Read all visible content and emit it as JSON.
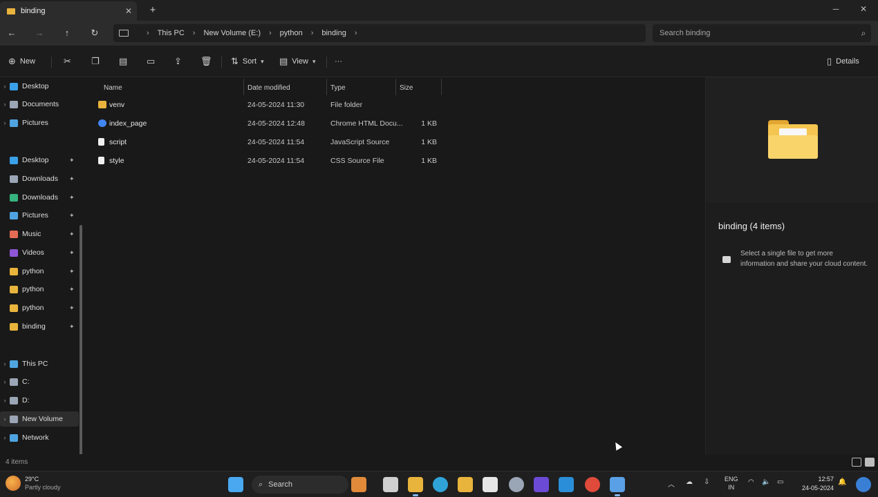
{
  "window": {
    "tab_title": "binding",
    "new_tab_label": "+",
    "tab_close_label": "✕",
    "minimize_label": "─",
    "close_label": "✕"
  },
  "address": {
    "breadcrumbs": [
      "This PC",
      "New Volume (E:)",
      "python",
      "binding"
    ]
  },
  "search": {
    "placeholder": "Search binding"
  },
  "commands": {
    "new_label": "New",
    "sort_label": "Sort",
    "view_label": "View",
    "more_label": "···",
    "details_label": "Details"
  },
  "nav": {
    "items": [
      {
        "label": "Desktop",
        "color": "#3aa0e8",
        "pinned": false,
        "chevron": true
      },
      {
        "label": "Documents",
        "color": "#9aa5b5",
        "pinned": false,
        "chevron": true
      },
      {
        "label": "Pictures",
        "color": "#4fa3e0",
        "pinned": false,
        "chevron": true
      },
      {
        "label": "Desktop",
        "color": "#3aa0e8",
        "pinned": true,
        "chevron": false
      },
      {
        "label": "Downloads",
        "color": "#9aa5b5",
        "pinned": true,
        "chevron": false
      },
      {
        "label": "Downloads",
        "color": "#36b37e",
        "pinned": true,
        "chevron": false
      },
      {
        "label": "Pictures",
        "color": "#4fa3e0",
        "pinned": true,
        "chevron": false
      },
      {
        "label": "Music",
        "color": "#e56b55",
        "pinned": true,
        "chevron": false
      },
      {
        "label": "Videos",
        "color": "#8e55d6",
        "pinned": true,
        "chevron": false
      },
      {
        "label": "python",
        "color": "#e8b43c",
        "pinned": true,
        "chevron": false
      },
      {
        "label": "python",
        "color": "#e8b43c",
        "pinned": true,
        "chevron": false
      },
      {
        "label": "python",
        "color": "#e8b43c",
        "pinned": true,
        "chevron": false
      },
      {
        "label": "binding",
        "color": "#e8b43c",
        "pinned": true,
        "chevron": false
      },
      {
        "label": "This PC",
        "color": "#4fa3e0",
        "pinned": false,
        "chevron": true
      },
      {
        "label": "C:",
        "color": "#9aa5b5",
        "pinned": false,
        "chevron": true
      },
      {
        "label": "D:",
        "color": "#9aa5b5",
        "pinned": false,
        "chevron": true
      },
      {
        "label": "New Volume",
        "color": "#9aa5b5",
        "pinned": false,
        "chevron": true
      },
      {
        "label": "Network",
        "color": "#4fa3e0",
        "pinned": false,
        "chevron": true
      }
    ]
  },
  "columns": [
    "Name",
    "Date modified",
    "Type",
    "Size"
  ],
  "files": [
    {
      "name": "venv",
      "date": "24-05-2024 11:30",
      "type": "File folder",
      "size": "",
      "icon": "folder",
      "color": "#e8b43c"
    },
    {
      "name": "index_page",
      "date": "24-05-2024 12:48",
      "type": "Chrome HTML Docu...",
      "size": "1 KB",
      "icon": "chrome",
      "color": "#4285f4"
    },
    {
      "name": "script",
      "date": "24-05-2024 11:54",
      "type": "JavaScript Source",
      "size": "1 KB",
      "icon": "file",
      "color": "#d8d8d8"
    },
    {
      "name": "style",
      "date": "24-05-2024 11:54",
      "type": "CSS Source File",
      "size": "1 KB",
      "icon": "file",
      "color": "#d8d8d8"
    }
  ],
  "preview": {
    "title": "binding (4 items)",
    "message": "Select a single file to get more information and share your cloud content."
  },
  "status": {
    "item_count": "4 items"
  },
  "taskbar": {
    "weather_temp": "29°C",
    "weather_desc": "Partly cloudy",
    "search_label": "Search",
    "lang_line1": "ENG",
    "lang_line2": "IN",
    "time": "12:57",
    "date": "24-05-2024",
    "apps": [
      {
        "name": "start-icon",
        "color": "#4aa8f0"
      },
      {
        "name": "widgets-icon",
        "color": "#e08a3a"
      },
      {
        "name": "task-view-icon",
        "color": "#cfcfcf"
      },
      {
        "name": "file-explorer-icon",
        "color": "#e8b43c"
      },
      {
        "name": "edge-icon",
        "color": "#2fa3d8"
      },
      {
        "name": "folder-icon",
        "color": "#e8b43c"
      },
      {
        "name": "store-icon",
        "color": "#e6e6e6"
      },
      {
        "name": "settings-icon",
        "color": "#9aa5b5"
      },
      {
        "name": "editor-icon",
        "color": "#6b4ad6"
      },
      {
        "name": "vscode-icon",
        "color": "#2a8fd8"
      },
      {
        "name": "chrome-icon",
        "color": "#e04a3a"
      },
      {
        "name": "snipping-icon",
        "color": "#5aa0e6"
      }
    ]
  }
}
